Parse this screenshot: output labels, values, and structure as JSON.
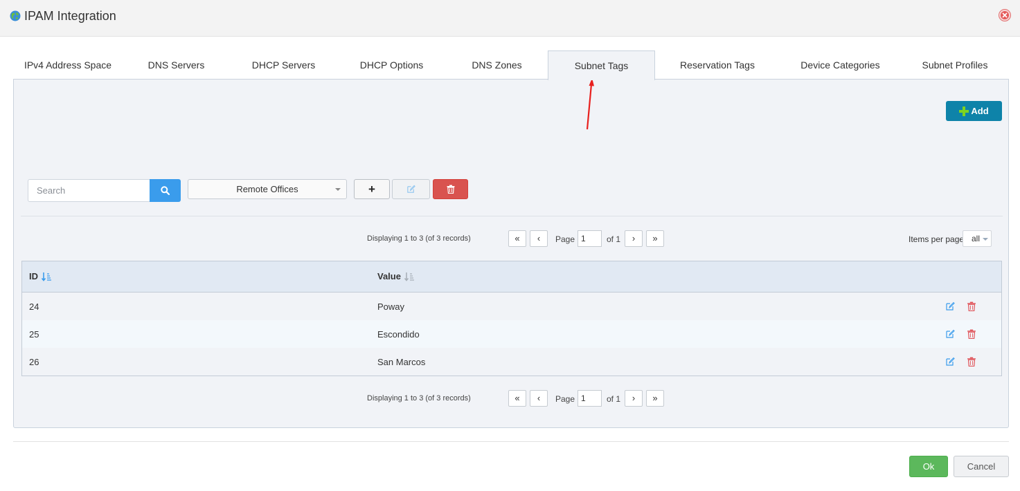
{
  "window": {
    "title": "IPAM Integration",
    "icon": "globe-icon",
    "close_icon": "close-circle-icon"
  },
  "tabs": [
    {
      "label": "IPv4 Address Space",
      "active": false
    },
    {
      "label": "DNS Servers",
      "active": false
    },
    {
      "label": "DHCP Servers",
      "active": false
    },
    {
      "label": "DHCP Options",
      "active": false
    },
    {
      "label": "DNS Zones",
      "active": false
    },
    {
      "label": "Subnet Tags",
      "active": true
    },
    {
      "label": "Reservation Tags",
      "active": false
    },
    {
      "label": "Device Categories",
      "active": false
    },
    {
      "label": "Subnet Profiles",
      "active": false
    }
  ],
  "toolbar": {
    "add_label": "Add",
    "search_placeholder": "Search",
    "search_value": "",
    "selected_tag": "Remote Offices",
    "plus_label": "+"
  },
  "pagination": {
    "displaying": "Displaying 1 to 3 (of 3 records)",
    "first": "«",
    "prev": "‹",
    "page_label": "Page",
    "page_value": "1",
    "of_label": "of 1",
    "next": "›",
    "last": "»",
    "items_per_page_label": "Items per page",
    "items_per_page_value": "all"
  },
  "table": {
    "columns": [
      "ID",
      "Value"
    ],
    "rows": [
      {
        "id": "24",
        "value": "Poway"
      },
      {
        "id": "25",
        "value": "Escondido"
      },
      {
        "id": "26",
        "value": "San Marcos"
      }
    ]
  },
  "footer": {
    "ok_label": "Ok",
    "cancel_label": "Cancel"
  },
  "colors": {
    "accent_add": "#0e83a9",
    "search_button": "#3a9cec",
    "delete_button": "#d9534f",
    "ok_button": "#5cb85c",
    "annotation_arrow": "#e8201e"
  }
}
